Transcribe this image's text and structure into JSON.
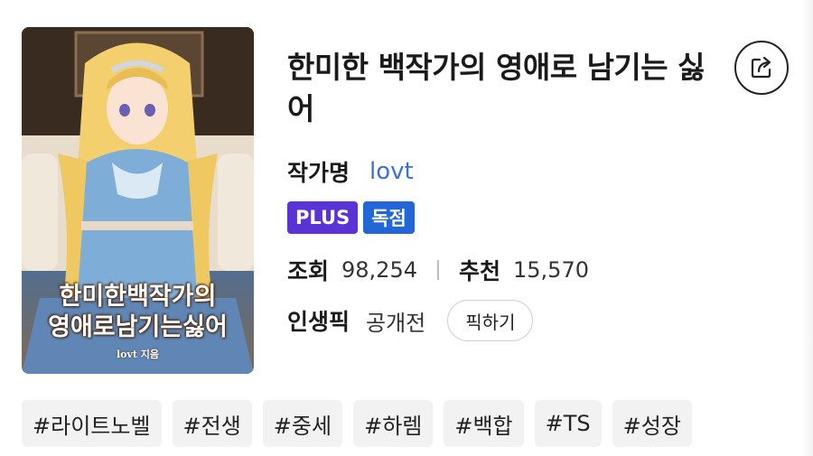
{
  "novel": {
    "title": "한미한 백작가의 영애로 남기는 싫어",
    "cover": {
      "title_line1": "한미한백작가의",
      "title_line2": "영애로남기는싫어",
      "author_caption": "lovt 지음"
    },
    "author_label": "작가명",
    "author_name": "lovt",
    "badges": {
      "plus": "PLUS",
      "exclusive": "독점"
    },
    "stats": {
      "views_label": "조회",
      "views_value": "98,254",
      "recommend_label": "추천",
      "recommend_value": "15,570"
    },
    "pick": {
      "label": "인생픽",
      "value": "공개전",
      "button_label": "픽하기"
    },
    "tags": [
      "#라이트노벨",
      "#전생",
      "#중세",
      "#하렘",
      "#백합",
      "#TS",
      "#성장"
    ]
  },
  "colors": {
    "author_link": "#3d6fd6",
    "plus_badge": "#5b32d6",
    "exclusive_badge": "#2266d8",
    "tag_bg": "#f2f2f2"
  },
  "icons": {
    "share": "share-icon"
  }
}
